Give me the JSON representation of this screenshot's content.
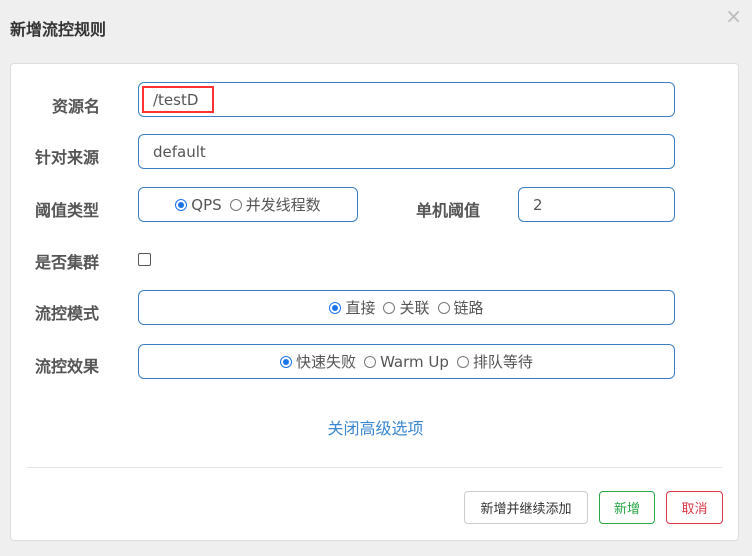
{
  "dialog": {
    "title": "新增流控规则",
    "close": "×"
  },
  "form": {
    "resource_label": "资源名",
    "resource_value": "/testD",
    "origin_label": "针对来源",
    "origin_value": "default",
    "threshold_type_label": "阈值类型",
    "threshold_type_options": [
      "QPS",
      "并发线程数"
    ],
    "threshold_label": "单机阈值",
    "threshold_value": "2",
    "cluster_label": "是否集群",
    "mode_label": "流控模式",
    "mode_options": [
      "直接",
      "关联",
      "链路"
    ],
    "effect_label": "流控效果",
    "effect_options": [
      "快速失败",
      "Warm Up",
      "排队等待"
    ],
    "advanced_link": "关闭高级选项"
  },
  "footer": {
    "add_continue": "新增并继续添加",
    "add": "新增",
    "cancel": "取消"
  },
  "colors": {
    "accent": "#3a7fc4",
    "add": "#28a745",
    "cancel": "#dc3545"
  }
}
